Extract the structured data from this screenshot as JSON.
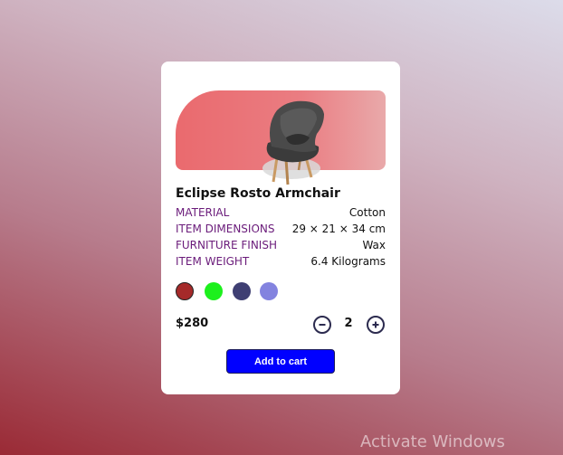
{
  "product": {
    "title": "Eclipse Rosto Armchair",
    "image": "armchair",
    "specs": [
      {
        "key": "MATERIAL",
        "value": "Cotton"
      },
      {
        "key": "ITEM DIMENSIONS",
        "value": "29 × 21 × 34 cm"
      },
      {
        "key": "FURNITURE FINISH",
        "value": "Wax"
      },
      {
        "key": "ITEM WEIGHT",
        "value": "6.4 Kilograms"
      }
    ],
    "colors": [
      "#a52a2a",
      "#1df01d",
      "#3f3f73",
      "#8383df"
    ],
    "selected_color": "#a52a2a",
    "price": "$280",
    "quantity": "2",
    "add_to_cart_label": "Add to cart"
  },
  "system": {
    "watermark": "Activate Windows"
  },
  "theme": {
    "hero_gradient": [
      "#ea6a6e",
      "#e9a9aa"
    ],
    "spec_key_color": "#6a1b7a",
    "button_color": "#0000ff"
  }
}
